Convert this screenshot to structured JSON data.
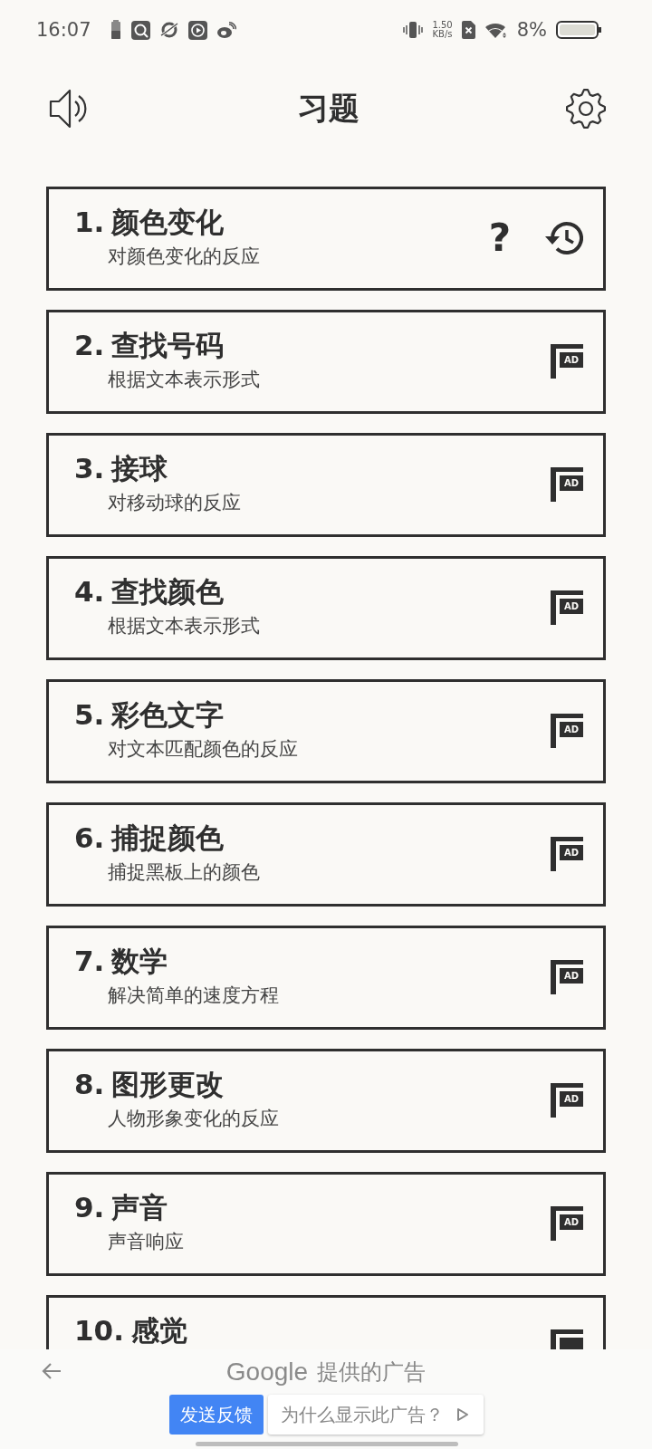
{
  "status_bar": {
    "time": "16:07",
    "net_speed": "1.50",
    "net_unit": "KB/s",
    "battery": "8%"
  },
  "header": {
    "title": "习题"
  },
  "tasks": [
    {
      "number": "1.",
      "title": "颜色变化",
      "subtitle": "对颜色变化的反应",
      "kind": "open",
      "help": "?"
    },
    {
      "number": "2.",
      "title": "查找号码",
      "subtitle": "根据文本表示形式",
      "kind": "ad",
      "badge": "AD"
    },
    {
      "number": "3.",
      "title": "接球",
      "subtitle": "对移动球的反应",
      "kind": "ad",
      "badge": "AD"
    },
    {
      "number": "4.",
      "title": "查找颜色",
      "subtitle": "根据文本表示形式",
      "kind": "ad",
      "badge": "AD"
    },
    {
      "number": "5.",
      "title": "彩色文字",
      "subtitle": "对文本匹配颜色的反应",
      "kind": "ad",
      "badge": "AD"
    },
    {
      "number": "6.",
      "title": "捕捉颜色",
      "subtitle": "捕捉黑板上的颜色",
      "kind": "ad",
      "badge": "AD"
    },
    {
      "number": "7.",
      "title": "数学",
      "subtitle": "解决简单的速度方程",
      "kind": "ad",
      "badge": "AD"
    },
    {
      "number": "8.",
      "title": "图形更改",
      "subtitle": "人物形象变化的反应",
      "kind": "ad",
      "badge": "AD"
    },
    {
      "number": "9.",
      "title": "声音",
      "subtitle": "声音响应",
      "kind": "ad",
      "badge": "AD"
    },
    {
      "number": "10.",
      "title": "感觉",
      "kind": "ad"
    }
  ],
  "ad_bar": {
    "provider": "Google",
    "caption": "提供的广告",
    "feedback_button": "发送反馈",
    "why_button": "为什么显示此广告？"
  }
}
